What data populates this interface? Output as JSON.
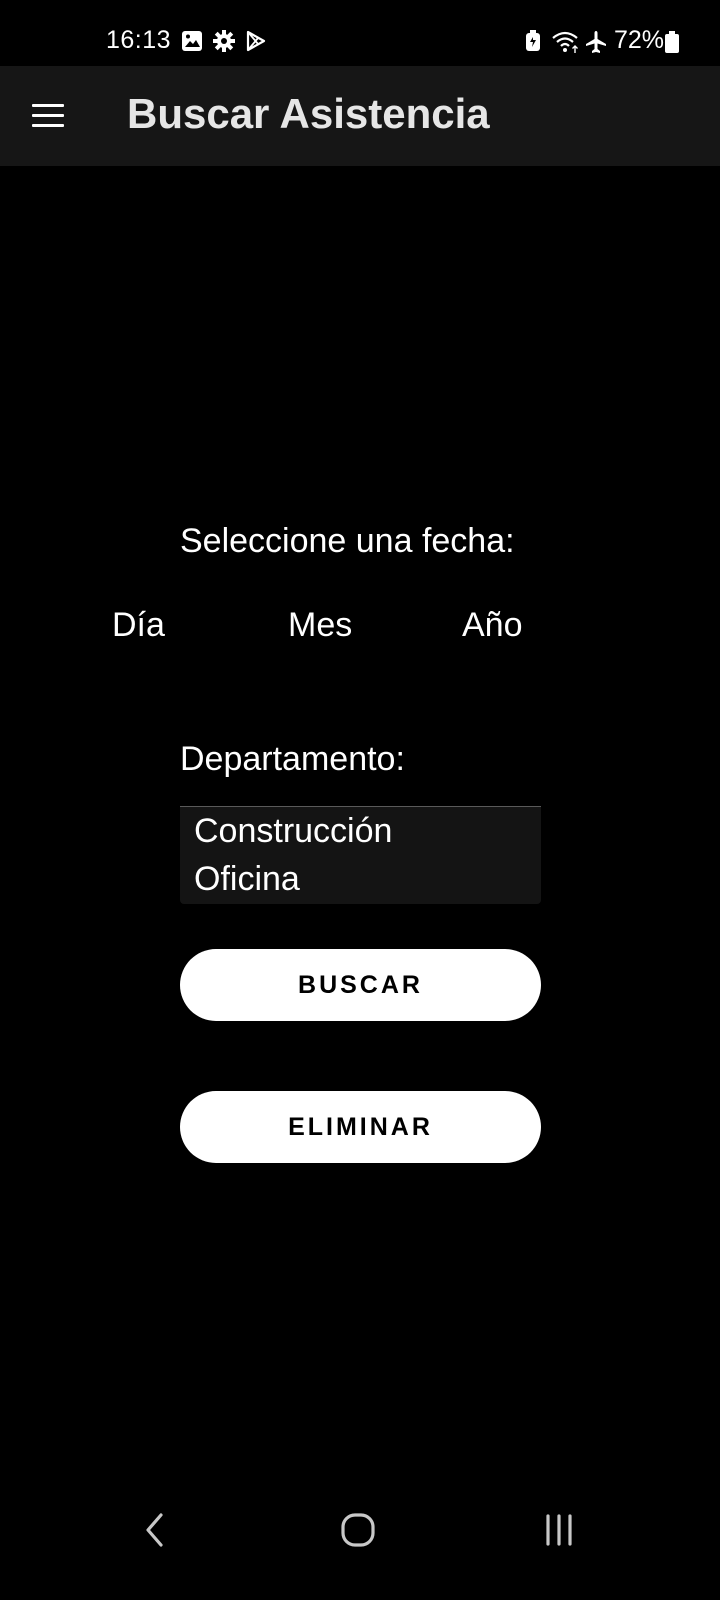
{
  "status_bar": {
    "time": "16:13",
    "battery": "72%",
    "icons": [
      "image-icon",
      "settings-icon",
      "play-store-icon",
      "battery-saver-icon",
      "wifi-icon",
      "airplane-icon",
      "battery-icon"
    ]
  },
  "app_bar": {
    "title": "Buscar Asistencia",
    "menu_icon": "hamburger-menu-icon"
  },
  "date": {
    "label": "Seleccione una fecha:",
    "day": "Día",
    "month": "Mes",
    "year": "Año"
  },
  "department": {
    "label": "Departamento:",
    "options": [
      "Construcción",
      "Oficina"
    ]
  },
  "buttons": {
    "search": "BUSCAR",
    "delete": "ELIMINAR"
  },
  "nav_bar": {
    "icons": [
      "back-icon",
      "home-icon",
      "recents-icon"
    ]
  },
  "colors": {
    "background": "#000000",
    "app_bar": "#161616",
    "button": "#ffffff",
    "button_text": "#000000",
    "list_background": "#141414"
  }
}
